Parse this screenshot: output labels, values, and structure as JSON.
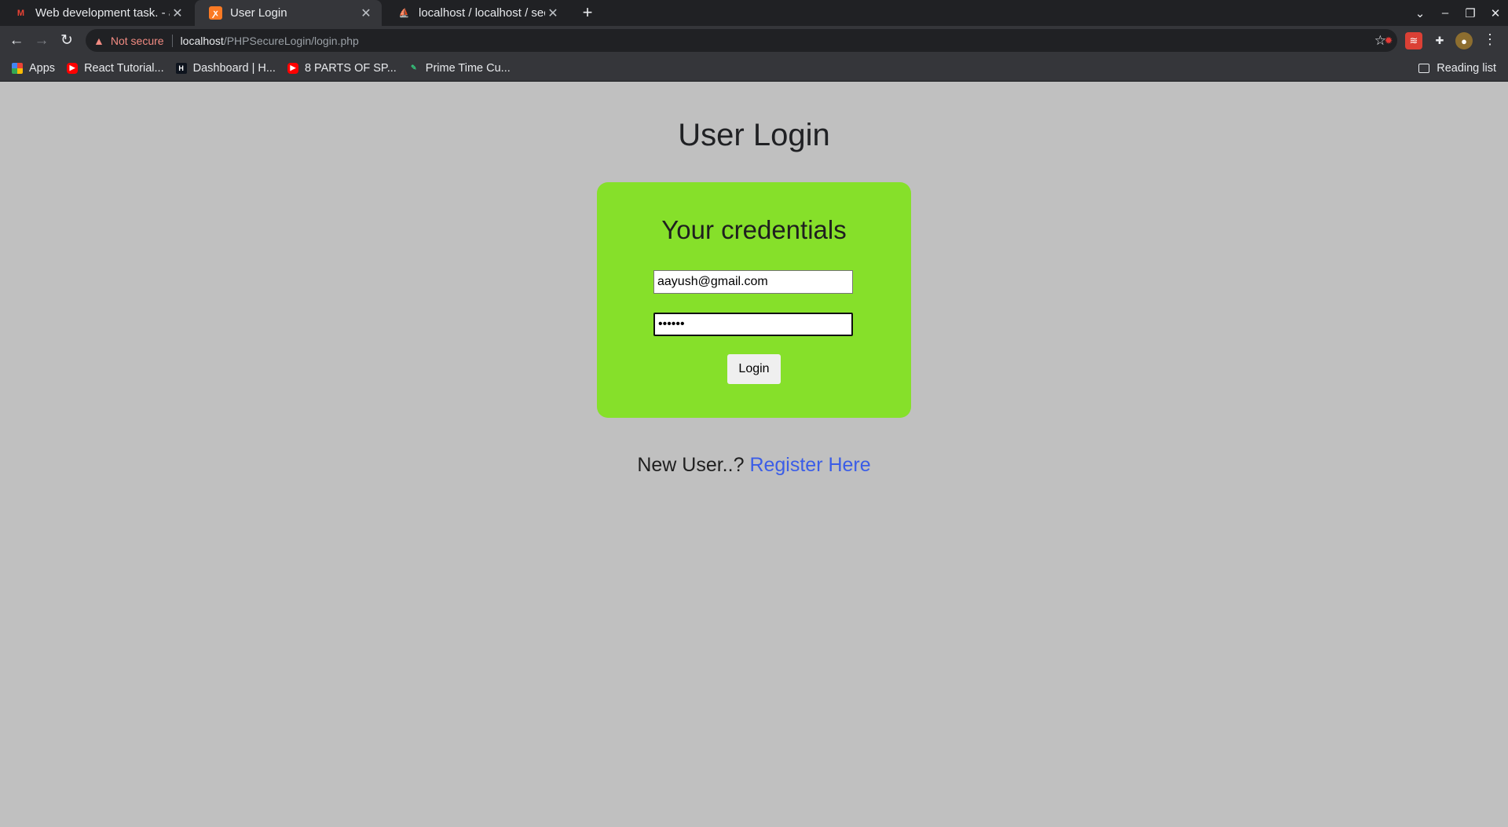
{
  "browser": {
    "tabs": [
      {
        "title": "Web development task. - a",
        "favicon": "gmail-icon",
        "active": false
      },
      {
        "title": "User Login",
        "favicon": "xampp-icon",
        "active": true
      },
      {
        "title": "localhost / localhost / sec",
        "favicon": "phpmyadmin-icon",
        "active": false
      }
    ],
    "new_tab_glyph": "+",
    "address": {
      "warning_text": "Not secure",
      "host": "localhost",
      "path": "/PHPSecureLogin/login.php"
    },
    "bookmarks": [
      {
        "label": "Apps",
        "icon": "apps-grid-icon"
      },
      {
        "label": "React Tutorial...",
        "icon": "youtube-icon"
      },
      {
        "label": "Dashboard | H...",
        "icon": "hackerrank-icon"
      },
      {
        "label": "8 PARTS OF SP...",
        "icon": "youtube-icon"
      },
      {
        "label": "Prime Time Cu...",
        "icon": "bookmark-leaf-icon"
      }
    ],
    "reading_list": "Reading list",
    "colors": {
      "tabstrip": "#202124",
      "toolbar": "#35363a",
      "warning": "#f28b82"
    }
  },
  "page": {
    "title": "User Login",
    "card": {
      "heading": "Your credentials",
      "email_value": "aayush@gmail.com",
      "password_value": "••••••",
      "login_label": "Login"
    },
    "register": {
      "prompt": "New User..?",
      "link_text": "Register Here"
    },
    "colors": {
      "background": "#c0c0c0",
      "card": "#86e02a",
      "link": "#3b5de7"
    }
  }
}
